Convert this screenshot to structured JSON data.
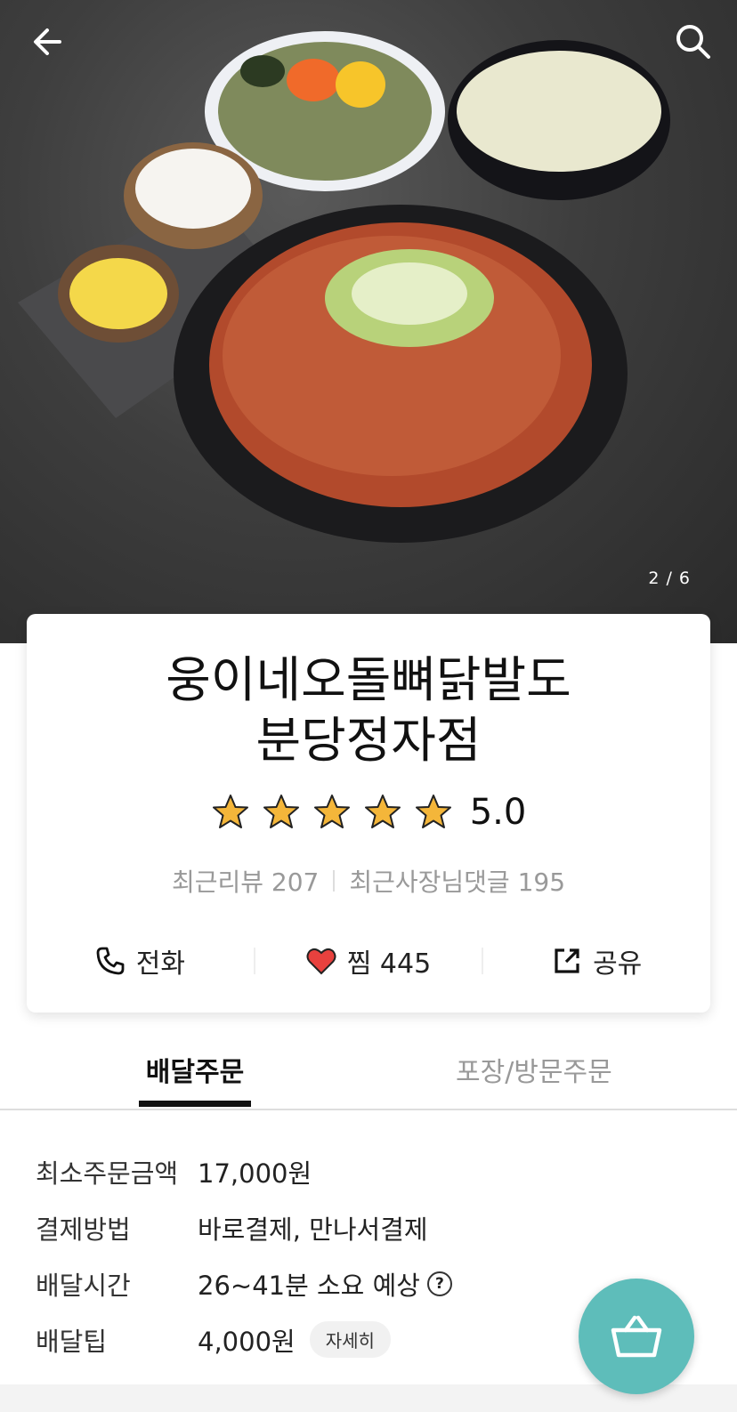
{
  "hero": {
    "counter": "2 / 6",
    "back_icon": "back-arrow-icon",
    "search_icon": "search-icon"
  },
  "store": {
    "name_line1": "웅이네오돌뼈닭발도",
    "name_line2": "분당정자점",
    "rating": 5.0,
    "rating_text": "5.0",
    "recent_reviews": "최근리뷰 207",
    "owner_replies": "최근사장님댓글 195"
  },
  "actions": {
    "call_label": "전화",
    "like_label": "찜 445",
    "share_label": "공유"
  },
  "tabs": {
    "delivery": "배달주문",
    "pickup": "포장/방문주문"
  },
  "info": {
    "min_order_label": "최소주문금액",
    "min_order_value": "17,000원",
    "payment_label": "결제방법",
    "payment_value": "바로결제, 만나서결제",
    "time_label": "배달시간",
    "time_value": "26~41분 소요 예상",
    "tip_label": "배달팁",
    "tip_value": "4,000원",
    "tip_detail": "자세히"
  },
  "colors": {
    "accent": "#5ebdba",
    "star": "#f4b63a",
    "heart": "#e8413e"
  }
}
